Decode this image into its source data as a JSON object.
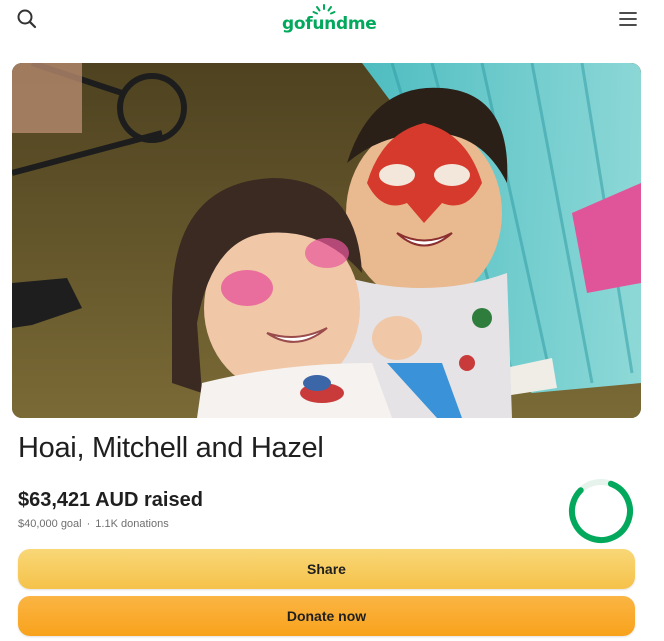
{
  "header": {
    "logo_text": "gofundme",
    "search_icon": "search-icon",
    "menu_icon": "hamburger-menu-icon",
    "brand_color": "#02a95c"
  },
  "campaign": {
    "title": "Hoai, Mitchell and Hazel",
    "raised_amount": "$63,421 AUD raised",
    "goal": "$40,000 goal",
    "separator": "·",
    "donations": "1.1K donations",
    "progress_fraction": 1.0,
    "progress_color": "#02a95c"
  },
  "actions": {
    "share_label": "Share",
    "donate_label": "Donate now",
    "share_color": "#f7cd5c",
    "donate_color": "#f9a92b"
  }
}
